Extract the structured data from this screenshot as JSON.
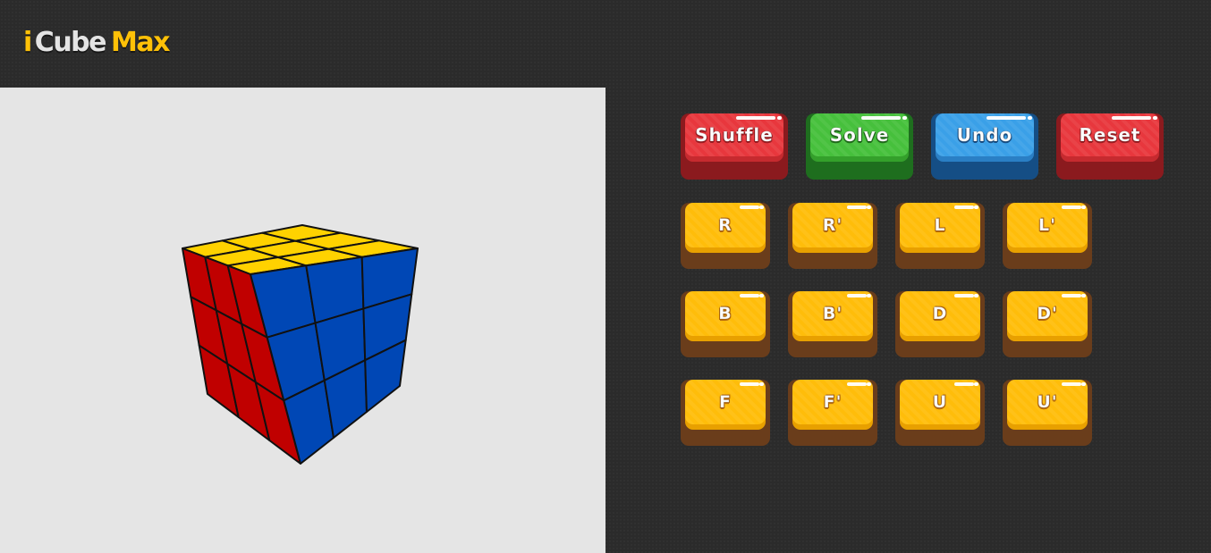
{
  "app": {
    "logo_i": "i",
    "logo_cube": "Cube",
    "logo_max": "Max"
  },
  "colors": {
    "accent": "#ffc107",
    "background": "#2b2b2b",
    "viewport": "#e5e5e5",
    "cube_top": "#ffd200",
    "cube_left": "#c00000",
    "cube_right": "#0047b5"
  },
  "controls": {
    "shuffle_label": "Shuffle",
    "solve_label": "Solve",
    "undo_label": "Undo",
    "reset_label": "Reset"
  },
  "moves": [
    [
      "R",
      "R'",
      "L",
      "L'"
    ],
    [
      "B",
      "B'",
      "D",
      "D'"
    ],
    [
      "F",
      "F'",
      "U",
      "U'"
    ]
  ]
}
